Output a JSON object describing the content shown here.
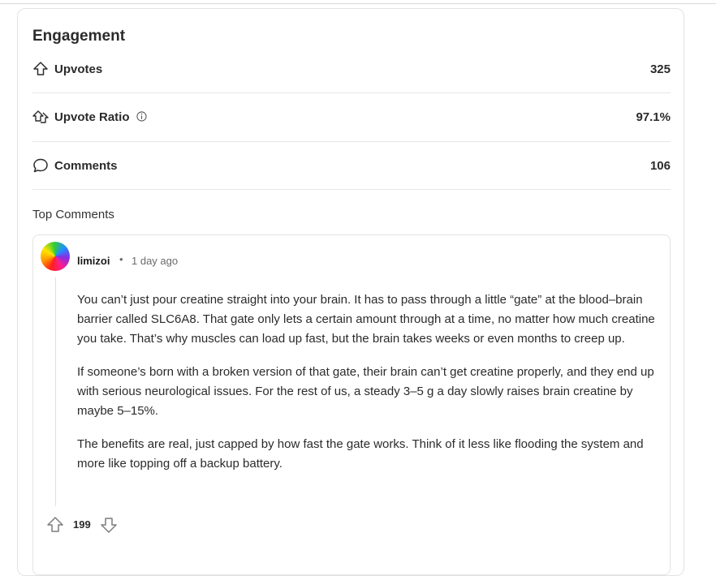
{
  "engagement": {
    "title": "Engagement",
    "stats": [
      {
        "label": "Upvotes",
        "value": "325",
        "icon": "arrow-up-outline-icon"
      },
      {
        "label": "Upvote Ratio",
        "value": "97.1%",
        "icon": "double-arrow-up-icon",
        "info_icon": "info-icon"
      },
      {
        "label": "Comments",
        "value": "106",
        "icon": "speech-bubble-icon"
      }
    ]
  },
  "top_comments": {
    "title": "Top Comments",
    "comments": [
      {
        "author": "limizoi",
        "separator": "•",
        "time": "1 day ago",
        "paragraphs": [
          "You can’t just pour creatine straight into your brain. It has to pass through a little “gate” at the blood–brain barrier called SLC6A8. That gate only lets a certain amount through at a time, no matter how much creatine you take. That’s why muscles can load up fast, but the brain takes weeks or even months to creep up.",
          "If someone’s born with a broken version of that gate, their brain can’t get creatine properly, and they end up with serious neurological issues. For the rest of us, a steady 3–5 g a day slowly raises brain creatine by maybe 5–15%.",
          "The benefits are real, just capped by how fast the gate works. Think of it less like flooding the system and more like topping off a backup battery."
        ],
        "score": "199"
      }
    ]
  }
}
